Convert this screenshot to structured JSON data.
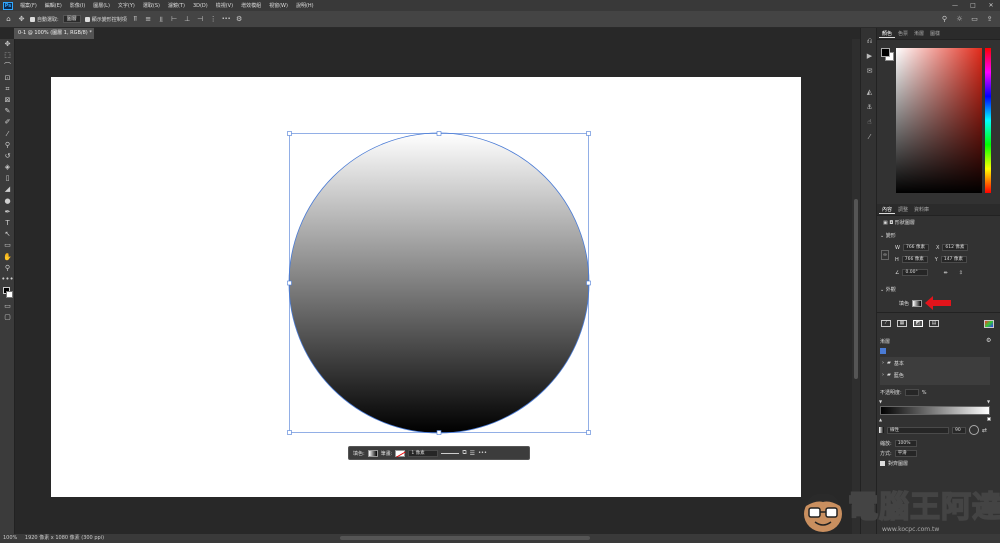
{
  "menubar": {
    "logo": "Ps",
    "items": [
      "檔案(F)",
      "編輯(E)",
      "影像(I)",
      "圖層(L)",
      "文字(Y)",
      "選取(S)",
      "濾鏡(T)",
      "3D(D)",
      "檢視(V)",
      "增效模組",
      "視窗(W)",
      "說明(H)"
    ],
    "window_controls": [
      "—",
      "□",
      "✕"
    ]
  },
  "optionsbar": {
    "auto_select_label": "自動選取:",
    "auto_select_value": "圖層",
    "show_transform_label": "顯示變形控制項",
    "more_label": "•••"
  },
  "document_tab": {
    "title": "0-1 @ 100% (圖層 1, RGB/8) *",
    "close": "×"
  },
  "tools": [
    "✥",
    "⬚",
    "⌒",
    "⊡",
    "⌗",
    "⊠",
    "✎",
    "✐",
    "⁄",
    "⚲",
    "↺",
    "◈",
    "▯",
    "◢",
    "●",
    "✒",
    "T",
    "↖",
    "▭",
    "✋",
    "⚲",
    "•••",
    "◩",
    "◰",
    "▭",
    "▢"
  ],
  "transform_toolbar": {
    "fill_label": "填色:",
    "stroke_label": "筆畫:",
    "stroke_width": "1 像素",
    "more": "•••"
  },
  "status": {
    "zoom": "100%",
    "info": "1920 像素 x 1080 像素 (300 ppi)"
  },
  "color_panel": {
    "tabs": [
      "顏色",
      "色票",
      "漸層",
      "圖樣"
    ],
    "active_tab": "顏色",
    "hue_color": "#e12a1a"
  },
  "properties_panel": {
    "tabs": [
      "內容",
      "調整",
      "資料庫"
    ],
    "active_tab": "內容",
    "layer_type": "形狀圖層",
    "transform_title": "變形",
    "w_label": "W",
    "w_value": "766 像素",
    "h_label": "H",
    "h_value": "766 像素",
    "x_label": "X",
    "x_value": "612 像素",
    "y_label": "Y",
    "y_value": "147 像素",
    "angle_value": "0.00°",
    "appearance_title": "外觀",
    "fill_label": "填色"
  },
  "gradient_panel": {
    "title": "漸層",
    "folders": [
      "基本",
      "藍色"
    ],
    "opacity_label": "不透明度:",
    "opacity_unit": "%",
    "style_value": "線性",
    "angle_value": "90",
    "scale_label": "縮放:",
    "scale_value": "100%",
    "method_label": "方式:",
    "method_value": "平滑",
    "align_label": "對齊圖層"
  },
  "watermark": {
    "text": "電腦王阿達",
    "url": "www.kocpc.com.tw"
  },
  "annotation": {
    "arrow_color": "#e3141b"
  },
  "accent": "#4a7bd5"
}
